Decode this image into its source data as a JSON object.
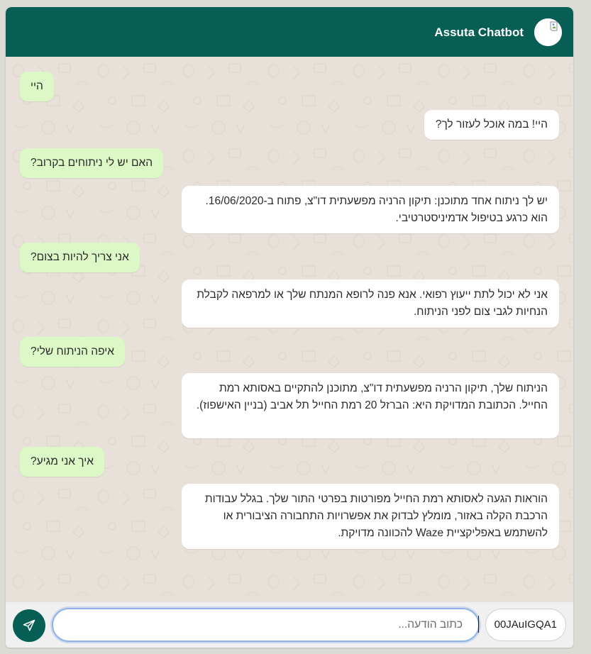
{
  "header": {
    "title": "Assuta Chatbot",
    "avatar_icon": "avatar-icon"
  },
  "colors": {
    "header_bg": "#075e54",
    "user_bubble": "#dcf8c6",
    "bot_bubble": "#ffffff",
    "chat_bg": "#e7e1d9",
    "send_button": "#075e54"
  },
  "messages": [
    {
      "sender": "user",
      "text": "היי"
    },
    {
      "sender": "bot",
      "text": "היי! במה אוכל לעזור לך?"
    },
    {
      "sender": "user",
      "text": "האם יש לי ניתוחים בקרוב?"
    },
    {
      "sender": "bot",
      "text": "יש לך ניתוח אחד מתוכנן: תיקון הרניה מפשעתית דו\"צ, פתוח ב-16/06/2020. הוא כרגע בטיפול אדמיניסטרטיבי."
    },
    {
      "sender": "user",
      "text": "אני צריך להיות בצום?"
    },
    {
      "sender": "bot",
      "text": "אני לא יכול לתת ייעוץ רפואי. אנא פנה לרופא המנתח שלך או למרפאה לקבלת הנחיות לגבי צום לפני הניתוח."
    },
    {
      "sender": "user",
      "text": "איפה הניתוח שלי?"
    },
    {
      "sender": "bot",
      "text": "הניתוח שלך, תיקון הרניה מפשעתית דו\"צ, מתוכנן להתקיים באסותא רמת החייל. הכתובת המדויקת היא: הברזל 20 רמת החייל תל אביב (בניין האישפוז)."
    },
    {
      "sender": "user",
      "text": "איך אני מגיע?"
    },
    {
      "sender": "bot",
      "text": "הוראות הגעה לאסותא רמת החייל מפורטות בפרטי התור שלך. בגלל עבודות הרכבת הקלה באזור, מומלץ לבדוק את אפשרויות התחבורה הציבורית או להשתמש באפליקציית Waze להכוונה מדויקת."
    }
  ],
  "input": {
    "placeholder": "כתוב הודעה...",
    "value": "",
    "send_icon": "send-icon"
  },
  "session": {
    "id_text": "00JAuIGQA1"
  }
}
